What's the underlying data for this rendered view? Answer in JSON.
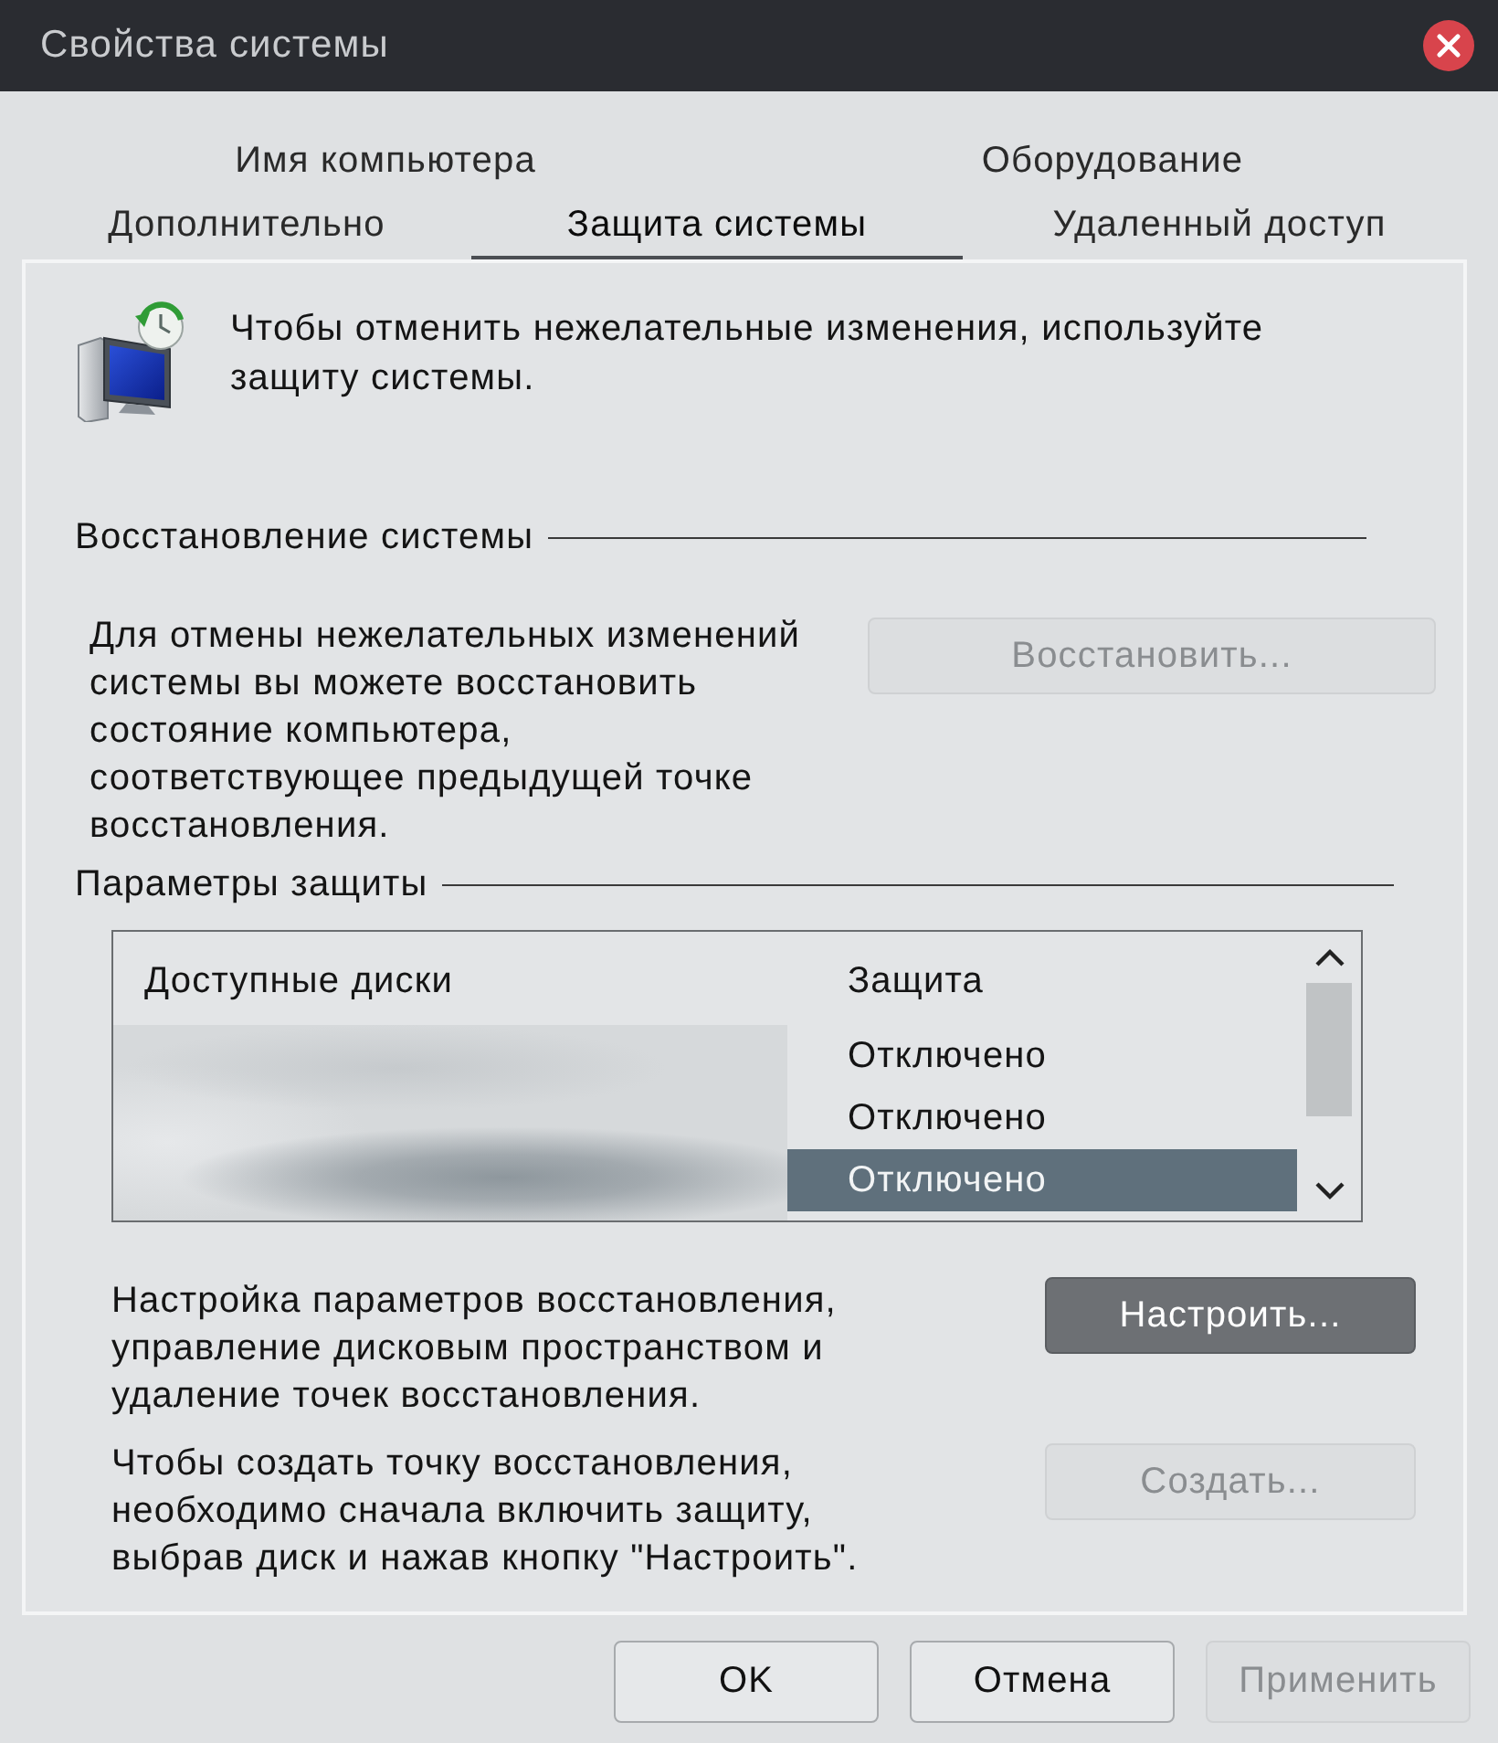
{
  "window": {
    "title": "Свойства системы"
  },
  "tab_rows": [
    [
      {
        "label": "Имя компьютера",
        "selected": false
      },
      {
        "label": "Оборудование",
        "selected": false
      }
    ],
    [
      {
        "label": "Дополнительно",
        "selected": false
      },
      {
        "label": "Защита системы",
        "selected": true
      },
      {
        "label": "Удаленный доступ",
        "selected": false
      }
    ]
  ],
  "intro": {
    "text": "Чтобы отменить нежелательные изменения, используйте\nзащиту системы."
  },
  "restore_group": {
    "title": "Восстановление системы",
    "description": "Для отмены нежелательных изменений\nсистемы вы можете восстановить\nсостояние компьютера,\nсоответствующее предыдущей точке\nвосстановления.",
    "button": {
      "label": "Восстановить...",
      "disabled": true,
      "highlighted": false
    }
  },
  "protection_group": {
    "title": "Параметры защиты",
    "list": {
      "columns": [
        "Доступные диски",
        "Защита"
      ],
      "rows": [
        {
          "protection": "Отключено",
          "selected": false
        },
        {
          "protection": "Отключено",
          "selected": false
        },
        {
          "protection": "Отключено",
          "selected": true
        }
      ]
    },
    "configure": {
      "description": "Настройка параметров восстановления,\nуправление дисковым пространством и\nудаление точек восстановления.",
      "button": {
        "label": "Настроить...",
        "disabled": false,
        "highlighted": true
      }
    },
    "create": {
      "description": "Чтобы создать точку восстановления,\nнеобходимо сначала включить защиту,\nвыбрав диск и нажав кнопку \"Настроить\".",
      "button": {
        "label": "Создать...",
        "disabled": true,
        "highlighted": false
      }
    }
  },
  "buttons": [
    {
      "label": "OK",
      "disabled": false,
      "highlighted": false
    },
    {
      "label": "Отмена",
      "disabled": false,
      "highlighted": false
    },
    {
      "label": "Применить",
      "disabled": true,
      "highlighted": false
    }
  ]
}
